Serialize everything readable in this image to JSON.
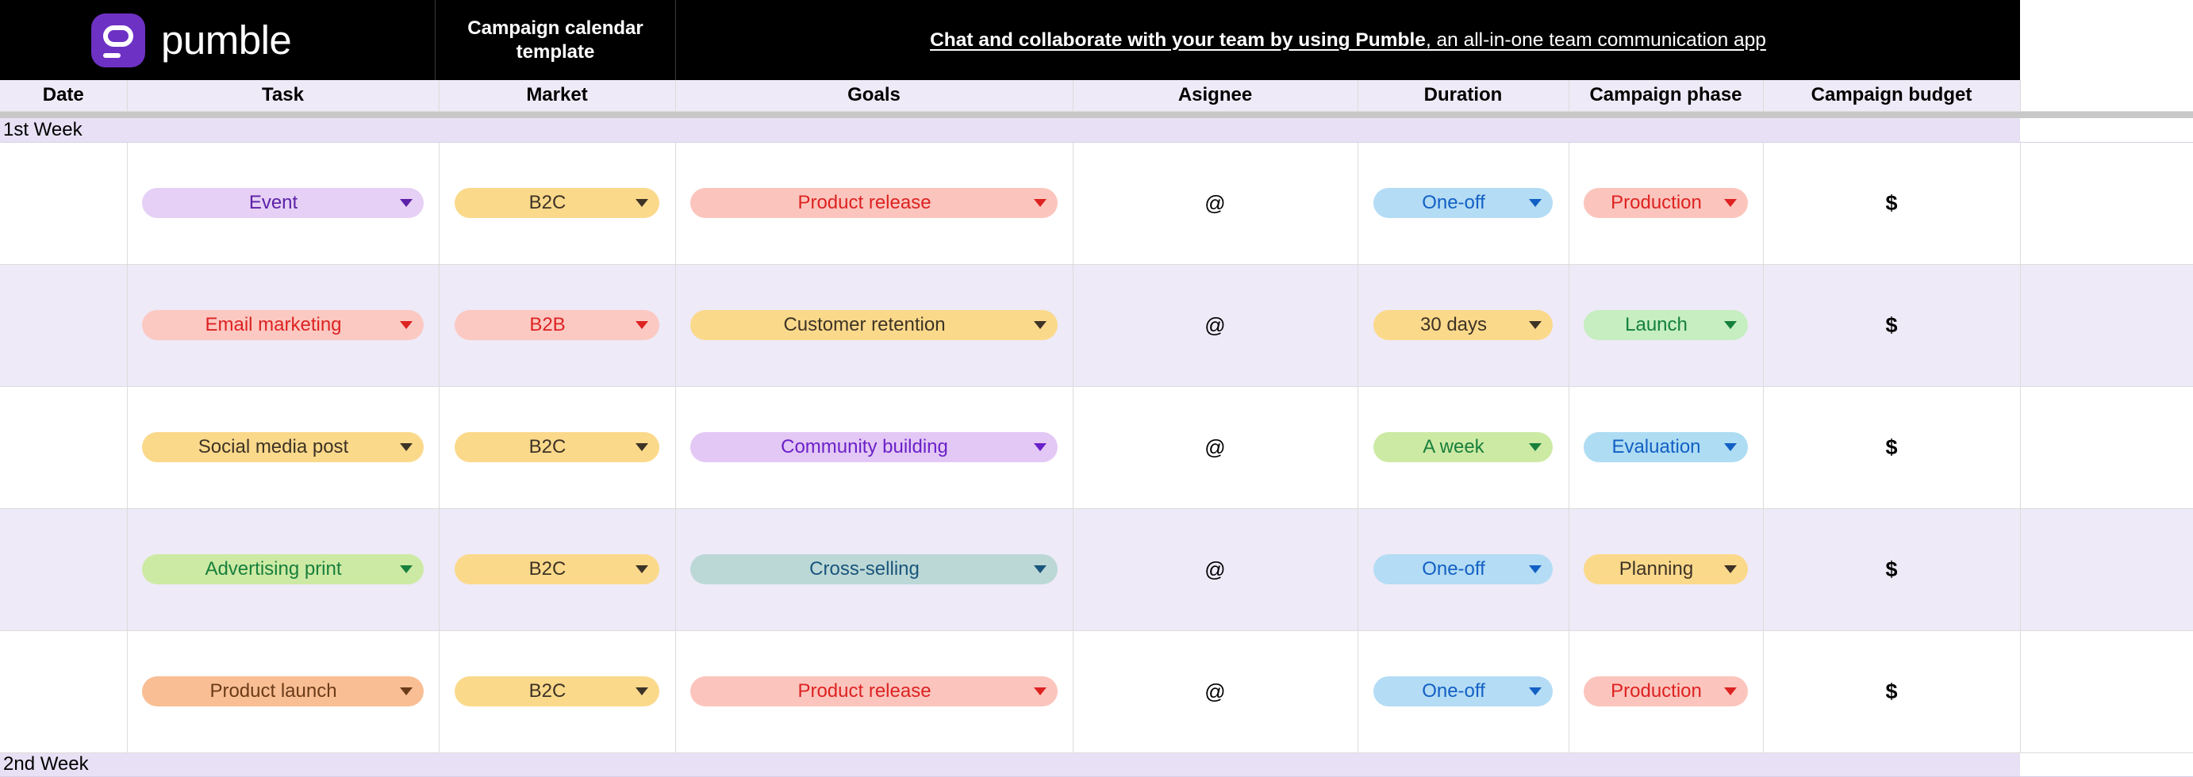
{
  "banner": {
    "logo_text": "pumble",
    "logo_icon": "pumble-logo-icon",
    "template_title": "Campaign calendar template",
    "promo_lead": "Chat and collaborate with your team by using Pumble",
    "promo_tail": ", an all-in-one team communication app",
    "background": "#000000",
    "logo_color": "#6d31c4"
  },
  "table": {
    "headers": [
      "Date",
      "Task",
      "Market",
      "Goals",
      "Asignee",
      "Duration",
      "Campaign phase",
      "Campaign budget",
      ""
    ],
    "sections": [
      {
        "label": "1st Week"
      },
      {
        "label": "2nd Week"
      }
    ],
    "assignee_symbol": "@",
    "budget_symbol": "$",
    "rows": [
      {
        "date": "",
        "task": {
          "label": "Event",
          "bg": "#e6d0f5",
          "fg": "#5b21a8"
        },
        "market": {
          "label": "B2C",
          "bg": "#fbd98b",
          "fg": "#3d3326"
        },
        "goals": {
          "label": "Product release",
          "bg": "#fbc5bd",
          "fg": "#dd2222"
        },
        "asignee": "@",
        "duration": {
          "label": "One-off",
          "bg": "#b4dcf5",
          "fg": "#1260c4"
        },
        "phase": {
          "label": "Production",
          "bg": "#fbc5bd",
          "fg": "#dd2222"
        },
        "budget": "$"
      },
      {
        "date": "",
        "task": {
          "label": "Email marketing",
          "bg": "#fbc9c2",
          "fg": "#dd2222"
        },
        "market": {
          "label": "B2B",
          "bg": "#fbc9c2",
          "fg": "#dd2222"
        },
        "goals": {
          "label": "Customer retention",
          "bg": "#fbd98b",
          "fg": "#3d3326"
        },
        "asignee": "@",
        "duration": {
          "label": "30 days",
          "bg": "#fbd98b",
          "fg": "#3d3326"
        },
        "phase": {
          "label": "Launch",
          "bg": "#c6eec1",
          "fg": "#14803c"
        },
        "budget": "$"
      },
      {
        "date": "",
        "task": {
          "label": "Social media post",
          "bg": "#fbd98b",
          "fg": "#3d3326"
        },
        "market": {
          "label": "B2C",
          "bg": "#fbd98b",
          "fg": "#3d3326"
        },
        "goals": {
          "label": "Community building",
          "bg": "#e3c8f5",
          "fg": "#6b21c8"
        },
        "asignee": "@",
        "duration": {
          "label": "A week",
          "bg": "#cdeaa4",
          "fg": "#18803c"
        },
        "phase": {
          "label": "Evaluation",
          "bg": "#aedcf3",
          "fg": "#1260c4"
        },
        "budget": "$"
      },
      {
        "date": "",
        "task": {
          "label": "Advertising print",
          "bg": "#cdeaa4",
          "fg": "#18803c"
        },
        "market": {
          "label": "B2C",
          "bg": "#fbd98b",
          "fg": "#3d3326"
        },
        "goals": {
          "label": "Cross-selling",
          "bg": "#bcd8d6",
          "fg": "#19557c"
        },
        "asignee": "@",
        "duration": {
          "label": "One-off",
          "bg": "#b4dcf5",
          "fg": "#1260c4"
        },
        "phase": {
          "label": "Planning",
          "bg": "#fbd98b",
          "fg": "#3d3326"
        },
        "budget": "$"
      },
      {
        "date": "",
        "task": {
          "label": "Product launch",
          "bg": "#f9be94",
          "fg": "#6b3b18"
        },
        "market": {
          "label": "B2C",
          "bg": "#fbd98b",
          "fg": "#3d3326"
        },
        "goals": {
          "label": "Product release",
          "bg": "#fbc5bd",
          "fg": "#dd2222"
        },
        "asignee": "@",
        "duration": {
          "label": "One-off",
          "bg": "#b4dcf5",
          "fg": "#1260c4"
        },
        "phase": {
          "label": "Production",
          "bg": "#fbc5bd",
          "fg": "#dd2222"
        },
        "budget": "$"
      }
    ]
  },
  "colors": {
    "header_bg": "#eeeaf7",
    "section_bg": "#e8e1f5",
    "row_alt_bg": "#eeeaf7",
    "grid_line": "#dcdcdc",
    "spacer_bar": "#c8c8c8"
  }
}
